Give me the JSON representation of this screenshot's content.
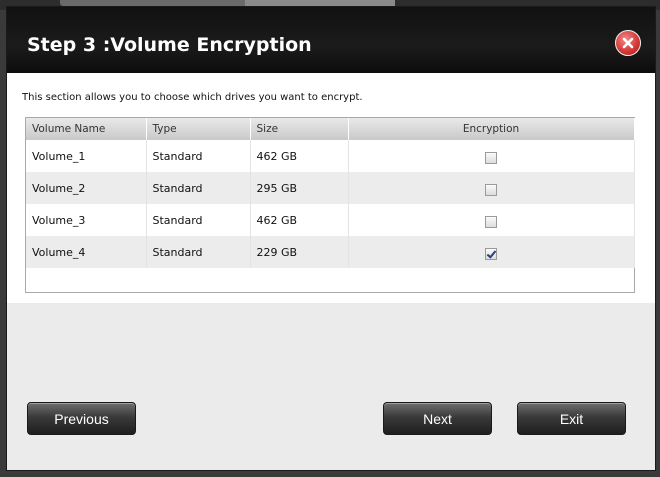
{
  "dialog": {
    "title": "Step 3 :Volume Encryption",
    "description": "This section allows you to choose which drives you want to encrypt."
  },
  "table": {
    "headers": [
      "Volume Name",
      "Type",
      "Size",
      "Encryption"
    ],
    "rows": [
      {
        "name": "Volume_1",
        "type": "Standard",
        "size": "462 GB",
        "encrypted": false
      },
      {
        "name": "Volume_2",
        "type": "Standard",
        "size": "295 GB",
        "encrypted": false
      },
      {
        "name": "Volume_3",
        "type": "Standard",
        "size": "462 GB",
        "encrypted": false
      },
      {
        "name": "Volume_4",
        "type": "Standard",
        "size": "229 GB",
        "encrypted": true
      }
    ]
  },
  "buttons": {
    "previous": "Previous",
    "next": "Next",
    "exit": "Exit"
  },
  "icons": {
    "close": "close-icon"
  },
  "colors": {
    "titlebar": "#111111",
    "close_button": "#d63a3a",
    "button": "#3a3a3a"
  }
}
